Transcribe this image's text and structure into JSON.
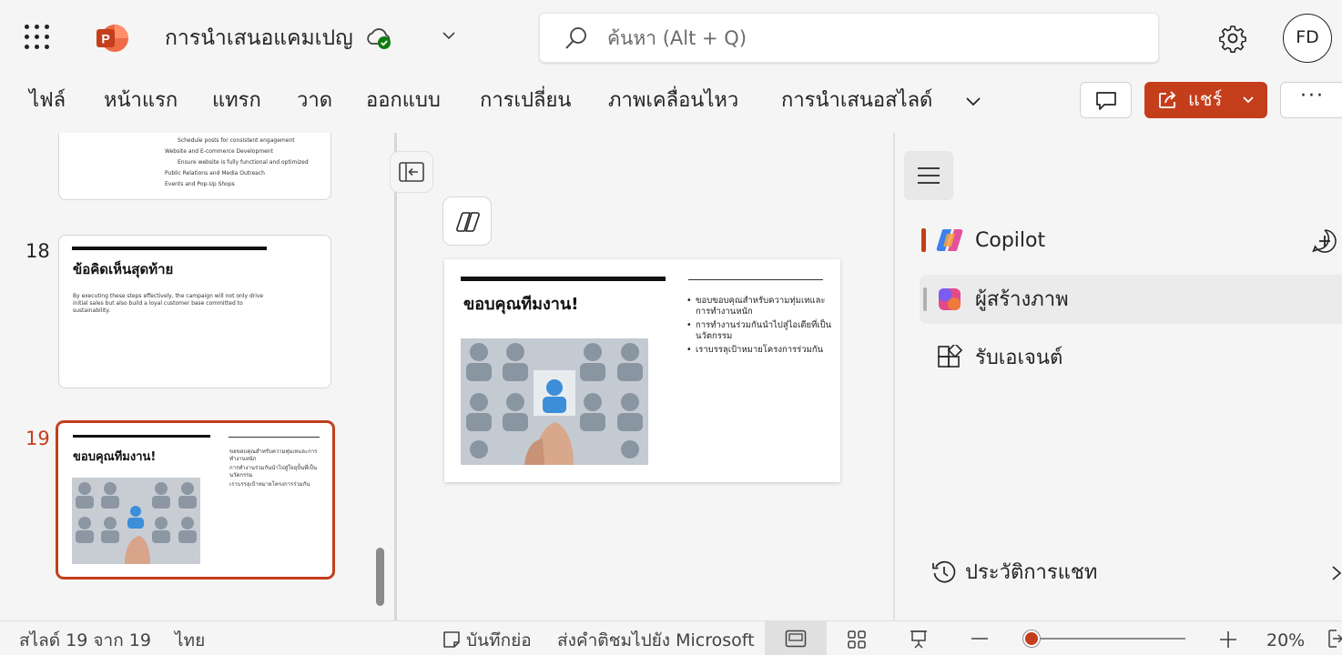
{
  "app": {
    "doc_title": "การนำเสนอแคมเปญ",
    "search_placeholder": "ค้นหา (Alt + Q)",
    "avatar_initials": "FD",
    "brand_color": "#c43e1c"
  },
  "ribbon": {
    "tabs": [
      "ไฟล์",
      "หน้าแรก",
      "แทรก",
      "วาด",
      "ออกแบบ",
      "การเปลี่ยน",
      "ภาพเคลื่อนไหว",
      "การนำเสนอสไลด์"
    ],
    "share_label": "แชร์",
    "more_label": "···"
  },
  "thumbnails": {
    "slide17_lines": [
      "Schedule posts for consistent engagement",
      "Website and E-commerce Development",
      "Ensure website is fully functional and optimized",
      "Public Relations and Media Outreach",
      "Events and Pop-Up Shops"
    ],
    "slide18": {
      "number": "18",
      "title": "ข้อคิดเห็นสุดท้าย",
      "body": "By executing these steps effectively, the campaign will not only drive initial sales but also build a loyal customer base committed to sustainability."
    },
    "slide19": {
      "number": "19",
      "title": "ขอบคุณทีมงาน!",
      "bullets": [
        "ขอขอบคุณสำหรับความทุ่มเทและการทำงานหนัก",
        "การทำงานร่วมกันนำไปสู่ใจอุปั้นที่เป็นนวัตกรรม",
        "เราบรรลุเป้าหมายโครงการร่วมกัน"
      ]
    }
  },
  "slide": {
    "title": "ขอบคุณทีมงาน!",
    "bullets": [
      "ขอบขอบคุณสำหรับความทุ่มเทและการทำงานหนัก",
      "การทำงานร่วมกันนำไปสู่ไอเดียที่เป็นนวัตกรรม",
      "เราบรรลุเป้าหมายโครงการร่วมกัน"
    ]
  },
  "side_pane": {
    "copilot": "Copilot",
    "image_creator": "ผู้สร้างภาพ",
    "get_agents": "รับเอเจนต์",
    "chat_history": "ประวัติการแชท"
  },
  "status": {
    "slide_count": "สไลด์ 19 จาก 19",
    "language": "ไทย",
    "notes": "บันทึกย่อ",
    "feedback": "ส่งคำติชมไปยัง Microsoft",
    "zoom": "20%",
    "zoom_level": 0.2
  }
}
